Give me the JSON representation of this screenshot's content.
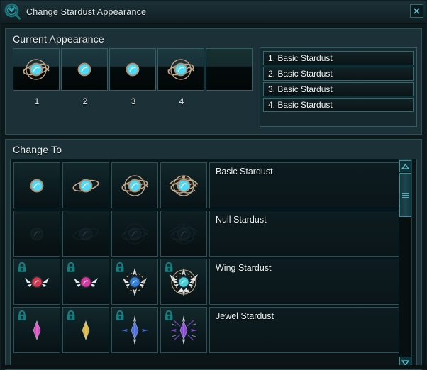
{
  "window": {
    "title": "Change Stardust Appearance",
    "icon": "stardust-magnifier-icon",
    "close_label": "×"
  },
  "theme": {
    "accent": "#3d8d94",
    "border": "#2f6068",
    "panel_bg": "#1c3137",
    "text": "#e8f1f2",
    "lock_color": "#167d7f"
  },
  "current_appearance": {
    "title": "Current Appearance",
    "slots": [
      {
        "number": "1",
        "icon": "stardust-ringed-orb-icon",
        "empty": false
      },
      {
        "number": "2",
        "icon": "stardust-plain-orb-icon",
        "empty": false
      },
      {
        "number": "3",
        "icon": "stardust-plain-orb-icon",
        "empty": false
      },
      {
        "number": "4",
        "icon": "stardust-ringed-orb-icon",
        "empty": false
      },
      {
        "number": "",
        "icon": "",
        "empty": true
      }
    ],
    "equipped_list": [
      {
        "label": "1. Basic Stardust"
      },
      {
        "label": "2. Basic Stardust"
      },
      {
        "label": "3. Basic Stardust"
      },
      {
        "label": "4. Basic Stardust"
      }
    ]
  },
  "change_to": {
    "title": "Change To",
    "rows": [
      {
        "label": "Basic Stardust",
        "locked": false,
        "dim": false,
        "cells": [
          {
            "icon": "basic-orb-stage1-icon",
            "color": "#4fd9f5"
          },
          {
            "icon": "basic-orb-stage2-icon",
            "color": "#4fd9f5"
          },
          {
            "icon": "basic-orb-stage3-icon",
            "color": "#4fd9f5"
          },
          {
            "icon": "basic-orb-stage4-icon",
            "color": "#4fd9f5"
          }
        ]
      },
      {
        "label": "Null Stardust",
        "locked": false,
        "dim": true,
        "cells": [
          {
            "icon": "null-orb-stage1-icon",
            "color": "#1a2b30"
          },
          {
            "icon": "null-orb-stage2-icon",
            "color": "#1a2b30"
          },
          {
            "icon": "null-orb-stage3-icon",
            "color": "#1a2b30"
          },
          {
            "icon": "null-orb-stage4-icon",
            "color": "#1a2b30"
          }
        ]
      },
      {
        "label": "Wing Stardust",
        "locked": true,
        "dim": false,
        "cells": [
          {
            "icon": "wing-orb-red-icon",
            "color": "#d8354e"
          },
          {
            "icon": "wing-orb-magenta-icon",
            "color": "#d5389f"
          },
          {
            "icon": "wing-orb-blue-icon",
            "color": "#2f7fe0"
          },
          {
            "icon": "wing-orb-cyan-icon",
            "color": "#46cfd8"
          }
        ]
      },
      {
        "label": "Jewel Stardust",
        "locked": true,
        "dim": false,
        "cells": [
          {
            "icon": "jewel-pink-icon",
            "color": "#d84bc0"
          },
          {
            "icon": "jewel-gold-icon",
            "color": "#d8b646"
          },
          {
            "icon": "jewel-blue-icon",
            "color": "#4a6ee0"
          },
          {
            "icon": "jewel-purple-icon",
            "color": "#8b4bd8"
          }
        ]
      }
    ],
    "scrollbar": {
      "up_icon": "triangle-up-icon",
      "down_icon": "triangle-down-icon",
      "thumb_icon": "grip-lines-icon"
    }
  }
}
